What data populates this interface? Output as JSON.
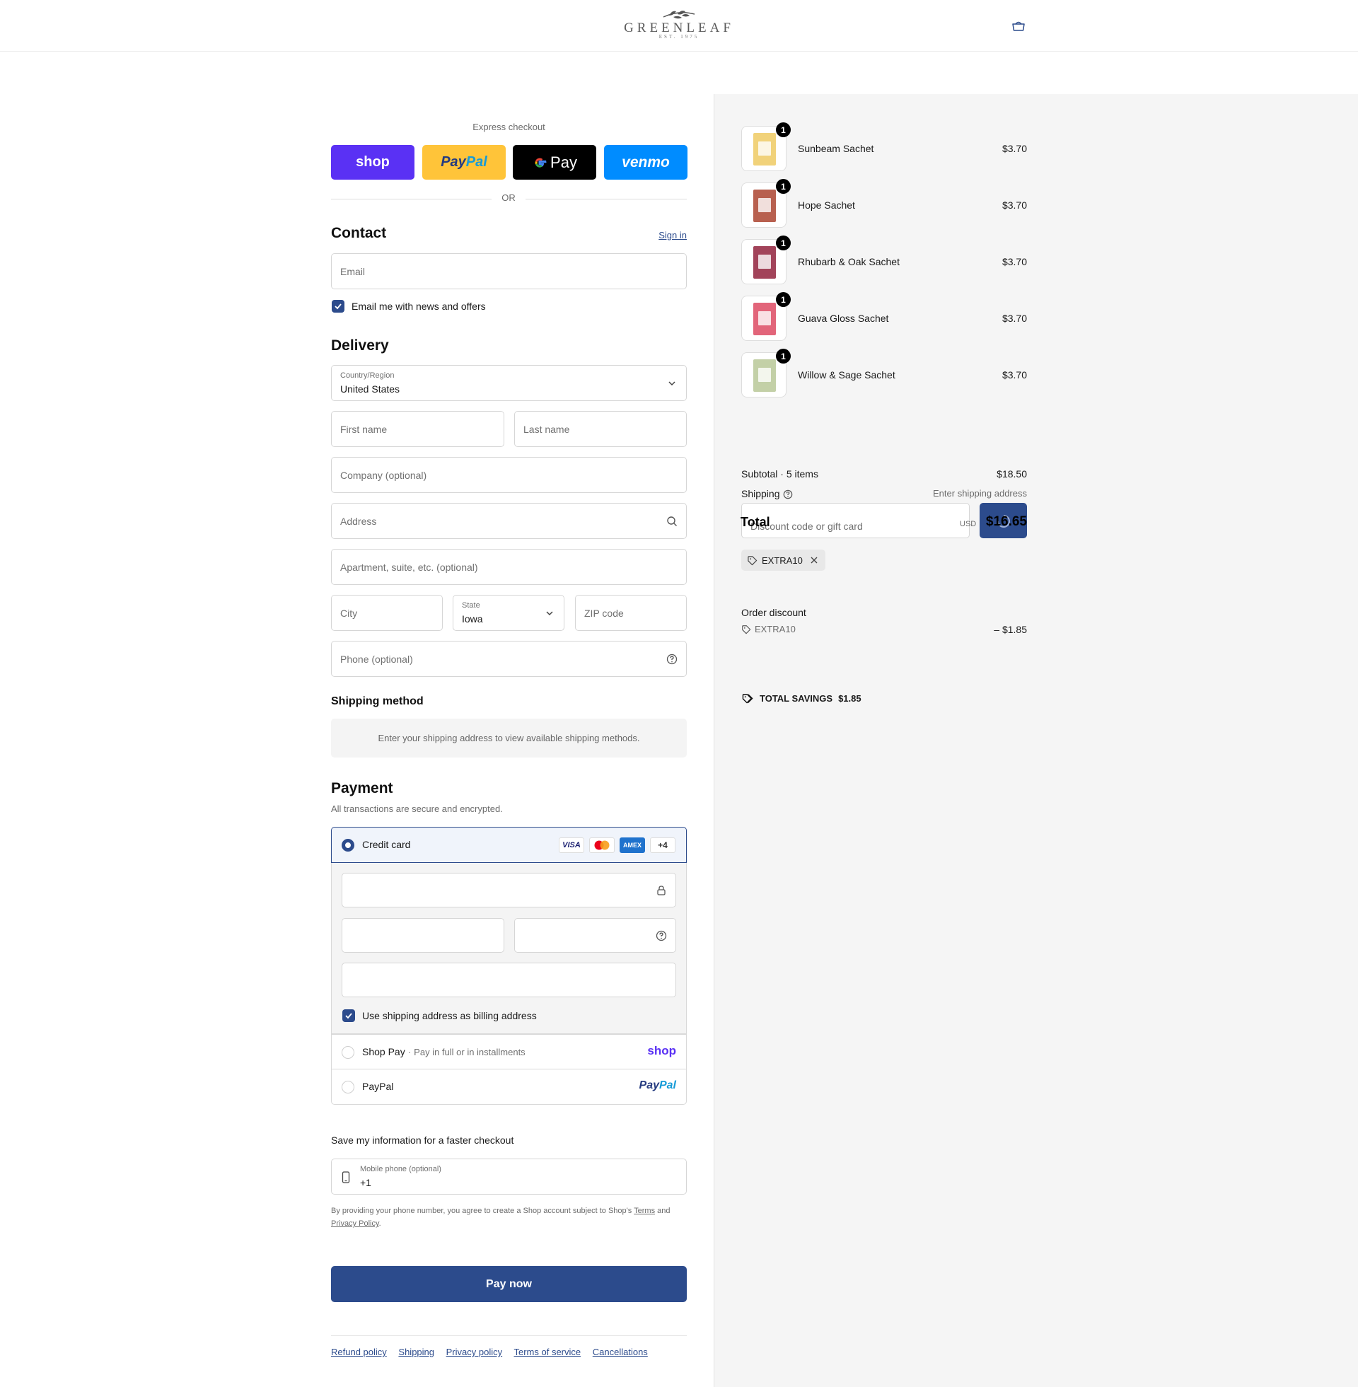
{
  "header": {
    "brand": "GREENLEAF",
    "est": "EST. 1975"
  },
  "express": {
    "title": "Express checkout",
    "buttons": {
      "shop": "shop",
      "paypal_a": "Pay",
      "paypal_b": "Pal",
      "gpay": "Pay",
      "venmo": "venmo"
    },
    "or": "OR"
  },
  "contact": {
    "title": "Contact",
    "sign_in": "Sign in",
    "email_placeholder": "Email",
    "newsletter_label": "Email me with news and offers"
  },
  "delivery": {
    "title": "Delivery",
    "country_label": "Country/Region",
    "country_value": "United States",
    "first_name": "First name",
    "last_name": "Last name",
    "company": "Company (optional)",
    "address": "Address",
    "apartment": "Apartment, suite, etc. (optional)",
    "city": "City",
    "state_label": "State",
    "state_value": "Iowa",
    "zip": "ZIP code",
    "phone": "Phone (optional)"
  },
  "shipping_method": {
    "title": "Shipping method",
    "message": "Enter your shipping address to view available shipping methods."
  },
  "payment": {
    "title": "Payment",
    "subtitle": "All transactions are secure and encrypted.",
    "credit_card_label": "Credit card",
    "card_brands": {
      "visa": "VISA",
      "amex": "AMEX",
      "more": "+4"
    },
    "billing_label": "Use shipping address as billing address",
    "shop_pay_label": "Shop Pay",
    "shop_pay_sub": "Pay in full or in installments",
    "shop_pay_logo": "shop",
    "paypal_label": "PayPal",
    "paypal_logo_a": "Pay",
    "paypal_logo_b": "Pal"
  },
  "save_info": {
    "title": "Save my information for a faster checkout",
    "mobile_label": "Mobile phone (optional)",
    "mobile_value": "+1",
    "disclaimer_a": "By providing your phone number, you agree to create a Shop account subject to Shop's",
    "terms": "Terms",
    "and": "and",
    "privacy": "Privacy Policy",
    "period": "."
  },
  "pay_now": "Pay now",
  "footer_links": [
    "Refund policy",
    "Shipping",
    "Privacy policy",
    "Terms of service",
    "Cancellations"
  ],
  "order": {
    "items": [
      {
        "name": "Sunbeam Sachet",
        "qty": "1",
        "price": "$3.70",
        "color": "#f1d27a"
      },
      {
        "name": "Hope Sachet",
        "qty": "1",
        "price": "$3.70",
        "color": "#b8604f"
      },
      {
        "name": "Rhubarb & Oak Sachet",
        "qty": "1",
        "price": "$3.70",
        "color": "#a2435a"
      },
      {
        "name": "Guava Gloss Sachet",
        "qty": "1",
        "price": "$3.70",
        "color": "#e2657a"
      },
      {
        "name": "Willow & Sage Sachet",
        "qty": "1",
        "price": "$3.70",
        "color": "#c3d0a7"
      }
    ],
    "subtotal_label": "Subtotal · 5 items",
    "subtotal_value": "$18.50",
    "shipping_label": "Shipping",
    "shipping_value": "Enter shipping address",
    "discount_placeholder": "Discount code or gift card",
    "total_label": "Total",
    "currency": "USD",
    "total_value": "$16.65",
    "applied_code": "EXTRA10",
    "order_discount_label": "Order discount",
    "order_discount_code": "EXTRA10",
    "order_discount_value": "– $1.85",
    "savings_label": "TOTAL SAVINGS",
    "savings_value": "$1.85"
  },
  "colors": {
    "primary": "#2c4b8c",
    "shop": "#5a31f4",
    "paypal_yellow": "#ffc439",
    "venmo": "#008cff"
  }
}
